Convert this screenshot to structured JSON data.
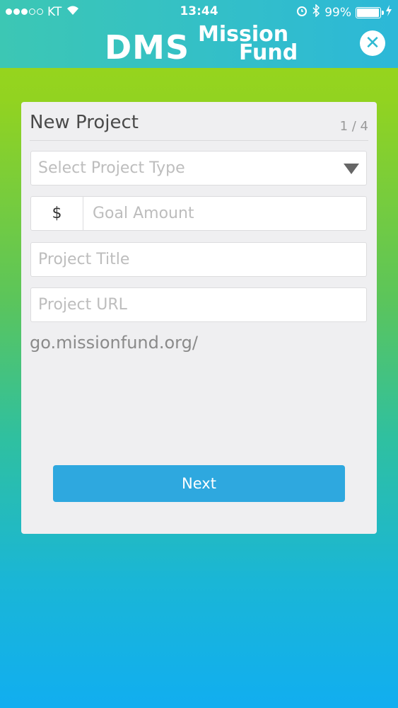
{
  "status_bar": {
    "carrier": "KT",
    "time": "13:44",
    "battery_percent": "99%",
    "signal_bars_filled": 3,
    "signal_bars_total": 5
  },
  "header": {
    "logo_dms": "DMS",
    "logo_mission": "Mission",
    "logo_fund": "Fund",
    "close_icon": "close-icon"
  },
  "form": {
    "title": "New Project",
    "step": "1 / 4",
    "project_type_placeholder": "Select Project Type",
    "currency_symbol": "$",
    "goal_amount_placeholder": "Goal Amount",
    "project_title_placeholder": "Project Title",
    "project_url_placeholder": "Project URL",
    "url_prefix_hint": "go.missionfund.org/",
    "next_label": "Next"
  },
  "colors": {
    "accent_button": "#2ea8df",
    "card_background": "#efeff1",
    "header_teal": "#34c0c6"
  }
}
